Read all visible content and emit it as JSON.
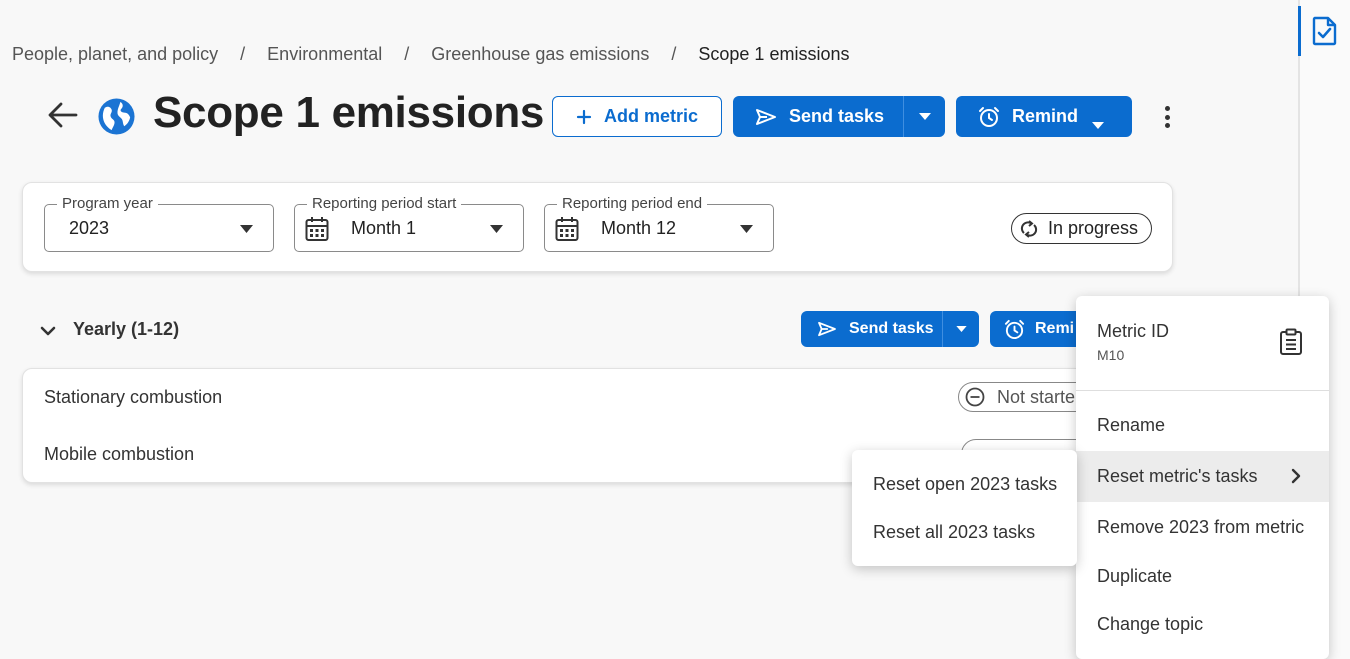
{
  "breadcrumb": {
    "items": [
      "People, planet, and policy",
      "Environmental",
      "Greenhouse gas emissions",
      "Scope 1 emissions"
    ],
    "separator": "/"
  },
  "header": {
    "title": "Scope 1 emissions",
    "add_metric_label": "Add metric",
    "send_tasks_label": "Send tasks",
    "remind_label": "Remind"
  },
  "filters": {
    "program_year": {
      "label": "Program year",
      "value": "2023"
    },
    "period_start": {
      "label": "Reporting period start",
      "value": "Month 1"
    },
    "period_end": {
      "label": "Reporting period end",
      "value": "Month 12"
    },
    "status": "In progress"
  },
  "section": {
    "title": "Yearly (1-12)",
    "send_tasks_label": "Send tasks",
    "remind_label": "Remi"
  },
  "metrics": [
    {
      "name": "Stationary combustion",
      "status": "Not starte"
    },
    {
      "name": "Mobile combustion"
    }
  ],
  "context_menu": {
    "metric_id_label": "Metric ID",
    "metric_id_value": "M10",
    "items": [
      "Rename",
      "Reset metric's tasks",
      "Remove 2023 from metric",
      "Duplicate",
      "Change topic"
    ]
  },
  "submenu": {
    "items": [
      "Reset open 2023 tasks",
      "Reset all 2023 tasks"
    ]
  },
  "colors": {
    "primary": "#0b6ccf",
    "text": "#333333",
    "background": "#f8f8f8"
  }
}
